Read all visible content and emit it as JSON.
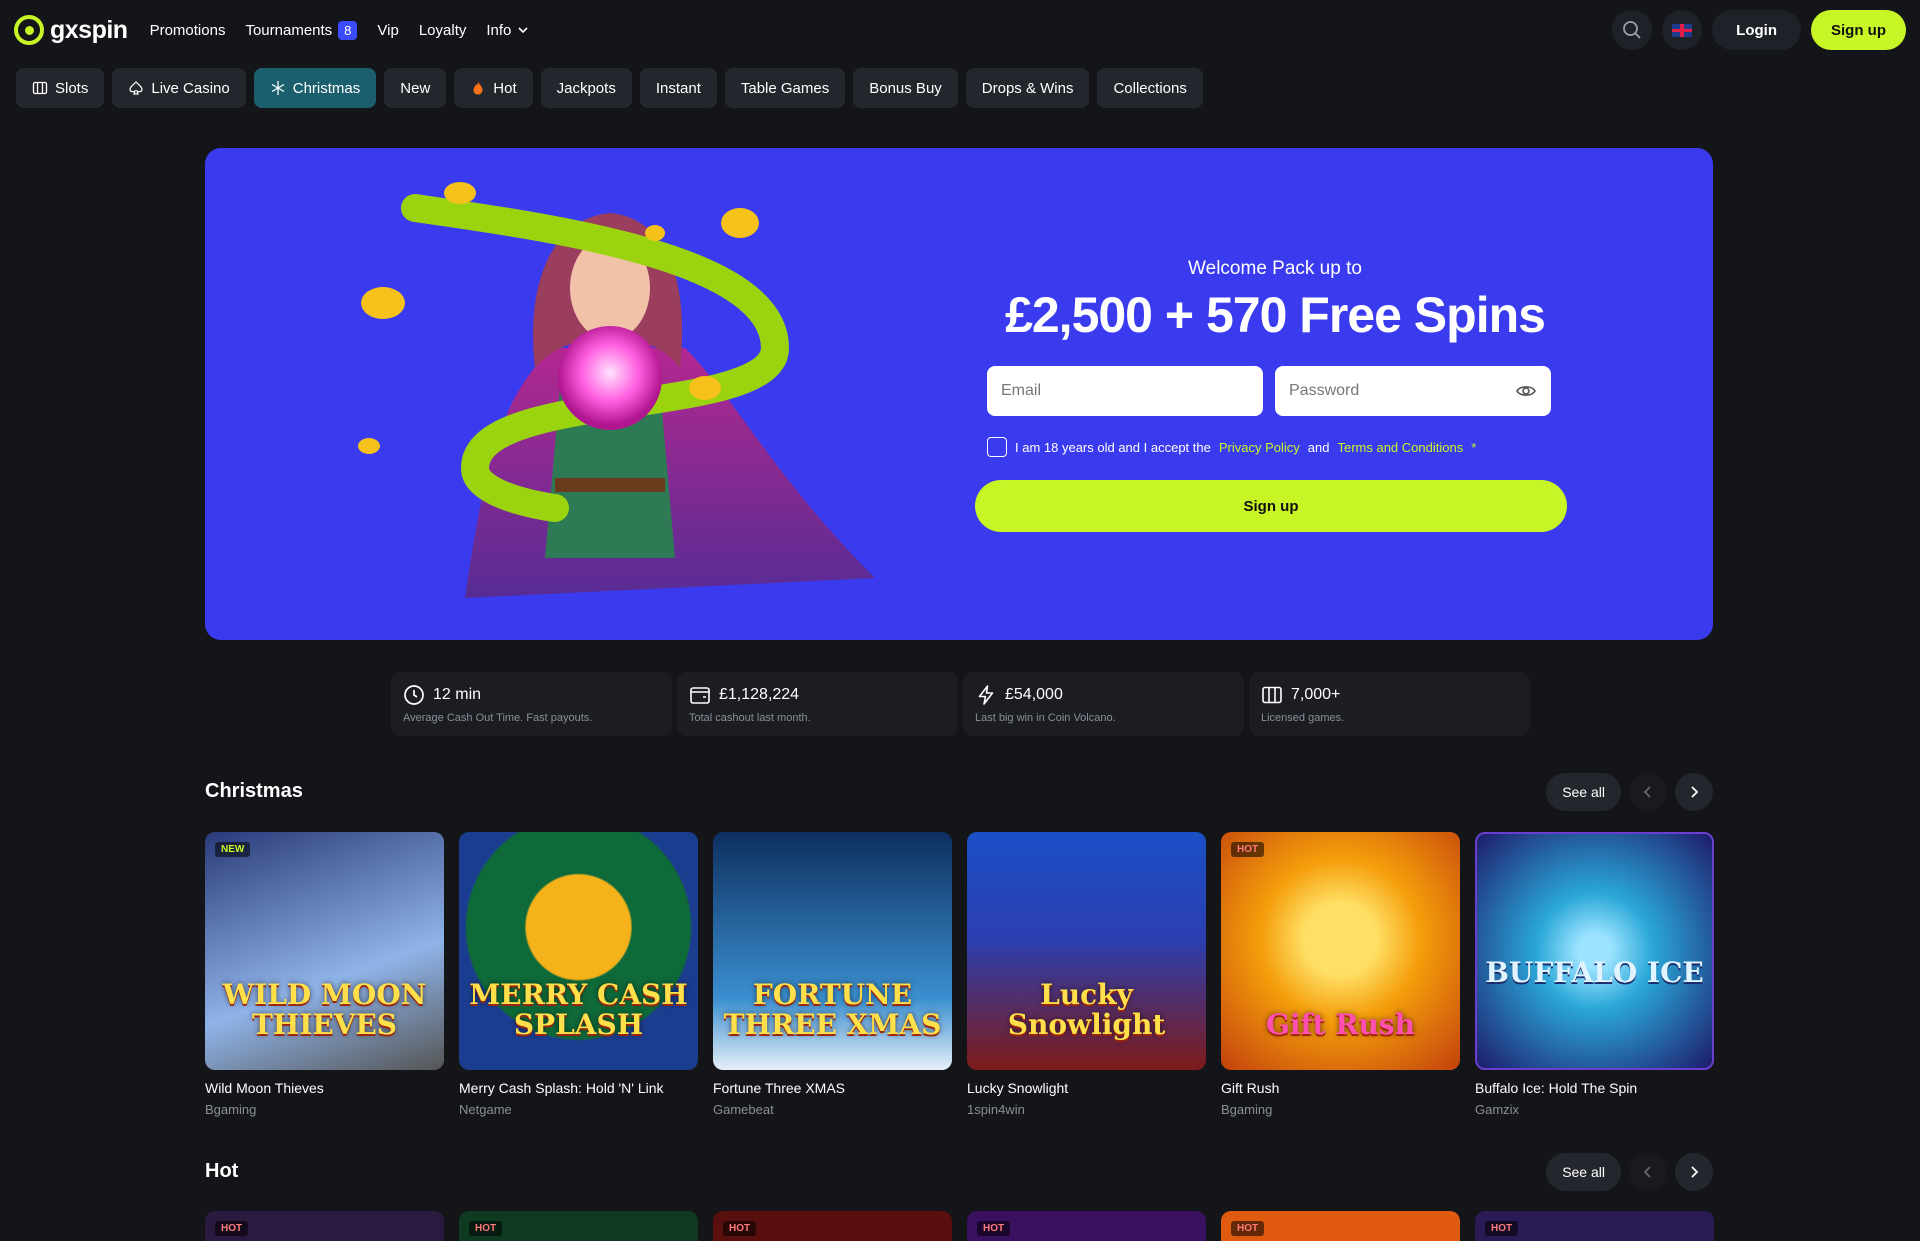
{
  "brand": {
    "name": "gxspin",
    "accent": "#c8f526",
    "hero_bg": "#3a3bef"
  },
  "nav": {
    "items": [
      {
        "label": "Promotions"
      },
      {
        "label": "Tournaments",
        "badge": "8"
      },
      {
        "label": "Vip"
      },
      {
        "label": "Loyalty"
      },
      {
        "label": "Info"
      }
    ]
  },
  "header": {
    "login": "Login",
    "signup": "Sign up"
  },
  "categories": [
    {
      "label": "Slots",
      "icon": "slots-icon"
    },
    {
      "label": "Live Casino",
      "icon": "spade-icon"
    },
    {
      "label": "Christmas",
      "icon": "snowflake-icon",
      "active": true
    },
    {
      "label": "New"
    },
    {
      "label": "Hot",
      "icon": "flame-icon"
    },
    {
      "label": "Jackpots"
    },
    {
      "label": "Instant"
    },
    {
      "label": "Table Games"
    },
    {
      "label": "Bonus Buy"
    },
    {
      "label": "Drops & Wins"
    },
    {
      "label": "Collections"
    }
  ],
  "hero": {
    "welcome": "Welcome Pack up to",
    "title": "£2,500 + 570 Free Spins",
    "email_placeholder": "Email",
    "password_placeholder": "Password",
    "agree_prefix": "I am 18 years old and I accept the",
    "privacy": "Privacy Policy",
    "and": "and",
    "terms": "Terms and Conditions",
    "required_mark": "*",
    "signup": "Sign up"
  },
  "stats": [
    {
      "value": "12 min",
      "label": "Average Cash Out Time. Fast payouts.",
      "icon": "clock-icon"
    },
    {
      "value": "£1,128,224",
      "label": "Total cashout last month.",
      "icon": "wallet-icon"
    },
    {
      "value": "£54,000",
      "label": "Last big win in Coin Volcano.",
      "icon": "lightning-icon"
    },
    {
      "value": "7,000+",
      "label": "Licensed games.",
      "icon": "slots-icon"
    }
  ],
  "christmas": {
    "title": "Christmas",
    "see_all": "See all",
    "games": [
      {
        "name": "Wild Moon Thieves",
        "provider": "Bgaming",
        "tag": "NEW",
        "art_title": "WILD MOON THIEVES",
        "colors": [
          "#2a3a7a",
          "#8fb3e8"
        ]
      },
      {
        "name": "Merry Cash Splash: Hold 'N' Link",
        "provider": "Netgame",
        "art_title": "MERRY CASH SPLASH",
        "colors": [
          "#0f6a3a",
          "#1b3d8f"
        ]
      },
      {
        "name": "Fortune Three XMAS",
        "provider": "Gamebeat",
        "art_title": "FORTUNE THREE XMAS",
        "colors": [
          "#0d2f5f",
          "#3b8fd0"
        ]
      },
      {
        "name": "Lucky Snowlight",
        "provider": "1spin4win",
        "art_title": "Lucky Snowlight",
        "colors": [
          "#1b4fc7",
          "#7e1b1b"
        ]
      },
      {
        "name": "Gift Rush",
        "provider": "Bgaming",
        "tag": "HOT",
        "art_title": "Gift Rush",
        "colors": [
          "#f59e0b",
          "#c2410c"
        ]
      },
      {
        "name": "Buffalo Ice: Hold The Spin",
        "provider": "Gamzix",
        "art_title": "BUFFALO ICE",
        "colors": [
          "#1e1b6b",
          "#2aa7d8"
        ]
      }
    ]
  },
  "hot": {
    "title": "Hot",
    "see_all": "See all",
    "tag": "HOT",
    "colors": [
      "#2b1a3f",
      "#0f3a22",
      "#5a0f0f",
      "#3a1060",
      "#e05a10",
      "#2a1a55"
    ]
  }
}
